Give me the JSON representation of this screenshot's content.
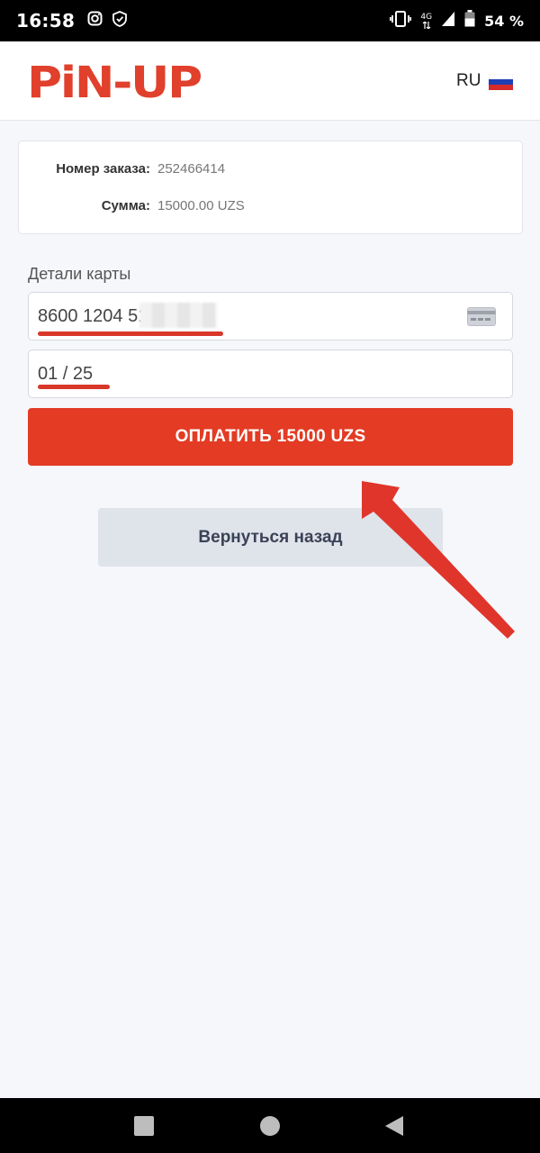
{
  "status_bar": {
    "time": "16:58",
    "network": "4G",
    "battery_text": "54 %",
    "icons": [
      "instagram-icon",
      "shield-icon",
      "vibrate-icon",
      "signal-icon",
      "battery-icon"
    ]
  },
  "header": {
    "logo_text": "PiN-UP",
    "language": "RU",
    "flag": "russia-flag-icon",
    "brand_color": "#e0402c"
  },
  "order": {
    "number_label": "Номер заказа:",
    "number_value": "252466414",
    "sum_label": "Сумма:",
    "sum_value": "15000.00 UZS"
  },
  "card": {
    "section_title": "Детали карты",
    "number_value": "8600 1204 51",
    "expiry_value": "01 / 25",
    "card_icon": "credit-card-icon"
  },
  "actions": {
    "pay_label": "ОПЛАТИТЬ 15000 UZS",
    "back_label": "Вернуться назад",
    "pay_color": "#e33b24"
  },
  "annotation": {
    "arrow_color": "#e0352b"
  },
  "nav_bar": {
    "icons": [
      "recent-apps-icon",
      "home-icon",
      "back-icon"
    ]
  }
}
